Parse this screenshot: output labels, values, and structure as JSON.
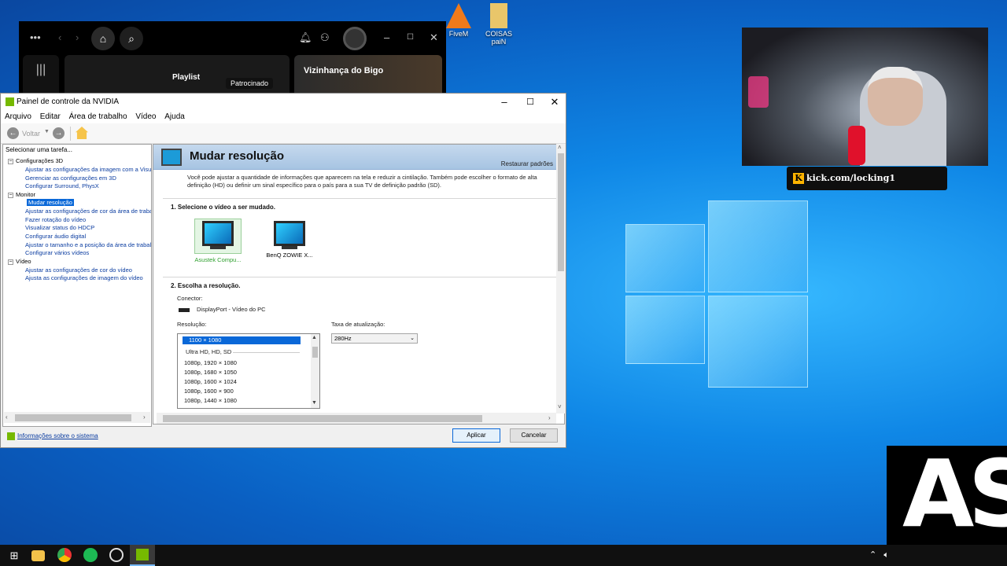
{
  "desktop": {
    "icons": [
      {
        "label": "FiveM"
      },
      {
        "label": "COISAS paiN"
      }
    ]
  },
  "spotify": {
    "playlist_label": "Playlist",
    "sponsored_label": "Patrocinado",
    "card_title": "Vizinhança do Bigo"
  },
  "overlay": {
    "kick_letter": "K",
    "kick_url": "kick.com/locking1",
    "brand_text": "AS"
  },
  "nvidia": {
    "title": "Painel de controle da NVIDIA",
    "menu": [
      "Arquivo",
      "Editar",
      "Área de trabalho",
      "Vídeo",
      "Ajuda"
    ],
    "toolbar": {
      "back_label": "Voltar"
    },
    "task_header": "Selecionar uma tarefa...",
    "tree": {
      "group1": "Configurações 3D",
      "group1_items": [
        "Ajustar as configurações da imagem com a Visualiz",
        "Gerenciar as configurações em 3D",
        "Configurar Surround, PhysX"
      ],
      "group2": "Monitor",
      "group2_items": [
        "Mudar resolução",
        "Ajustar as configurações de cor da área de trabal",
        "Fazer rotação do vídeo",
        "Visualizar status do HDCP",
        "Configurar áudio digital",
        "Ajustar o tamanho e a posição da área de trabalh",
        "Configurar vários vídeos"
      ],
      "group3": "Vídeo",
      "group3_items": [
        "Ajustar as configurações de cor do vídeo",
        "Ajusta as configurações de imagem do vídeo"
      ]
    },
    "page": {
      "title": "Mudar resolução",
      "restore_link": "Restaurar padrões",
      "description": "Você pode ajustar a quantidade de informações que aparecem na tela e reduzir a cintilação. Também pode escolher o formato de alta definição (HD) ou definir um sinal específico para o país para a sua TV de definição padrão (SD).",
      "section1": "1. Selecione o vídeo a ser mudado.",
      "monitors": [
        {
          "name": "Asustek Compu...",
          "selected": true
        },
        {
          "name": "BenQ ZOWIE X...",
          "selected": false
        }
      ],
      "section2": "2. Escolha a resolução.",
      "connector_label": "Conector:",
      "connector_value": "DisplayPort - Vídeo do PC",
      "resolution_label": "Resolução:",
      "resolution_selected": "1100 × 1080",
      "resolution_group": "Ultra HD, HD, SD",
      "resolutions": [
        "1080p, 1920 × 1080",
        "1080p, 1680 × 1050",
        "1080p, 1600 × 1024",
        "1080p, 1600 × 900",
        "1080p, 1440 × 1080"
      ],
      "refresh_label": "Taxa de atualização:",
      "refresh_value": "280Hz"
    },
    "footer": {
      "sysinfo": "Informações sobre o sistema",
      "apply": "Aplicar",
      "cancel": "Cancelar"
    }
  }
}
